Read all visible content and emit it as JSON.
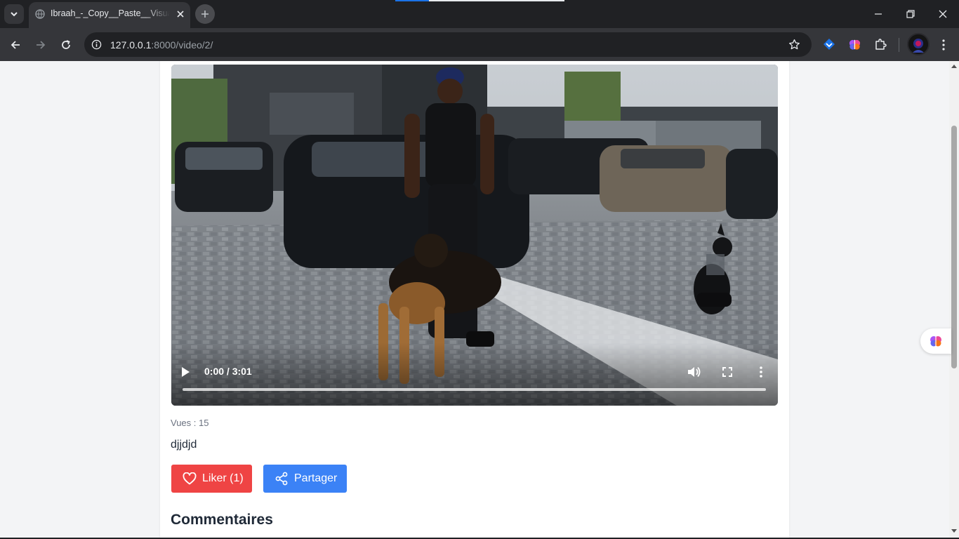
{
  "browser": {
    "tab_title": "Ibraah_-_Copy__Paste__Visualizer",
    "url_host": "127.0.0.1",
    "url_path": ":8000/video/2/",
    "icons": [
      "chevron-down-icon",
      "globe-icon",
      "close-icon",
      "plus-icon",
      "minimize-icon",
      "restore-icon",
      "close-window-icon",
      "back-icon",
      "forward-icon",
      "reload-icon",
      "info-icon",
      "star-icon",
      "extension-icons",
      "puzzle-icon",
      "avatar",
      "kebab-menu-icon"
    ]
  },
  "video": {
    "time_display": "0:00 / 3:01",
    "progress_fraction": 0,
    "icons": [
      "play-icon",
      "volume-icon",
      "fullscreen-icon",
      "more-vert-icon"
    ]
  },
  "page": {
    "views_text": "Vues : 15",
    "description": "djjdjd",
    "like_label": "Liker (1)",
    "share_label": "Partager",
    "comments_heading": "Commentaires"
  },
  "colors": {
    "like": "#ef4444",
    "share": "#3b82f6",
    "background": "#f3f4f6"
  }
}
